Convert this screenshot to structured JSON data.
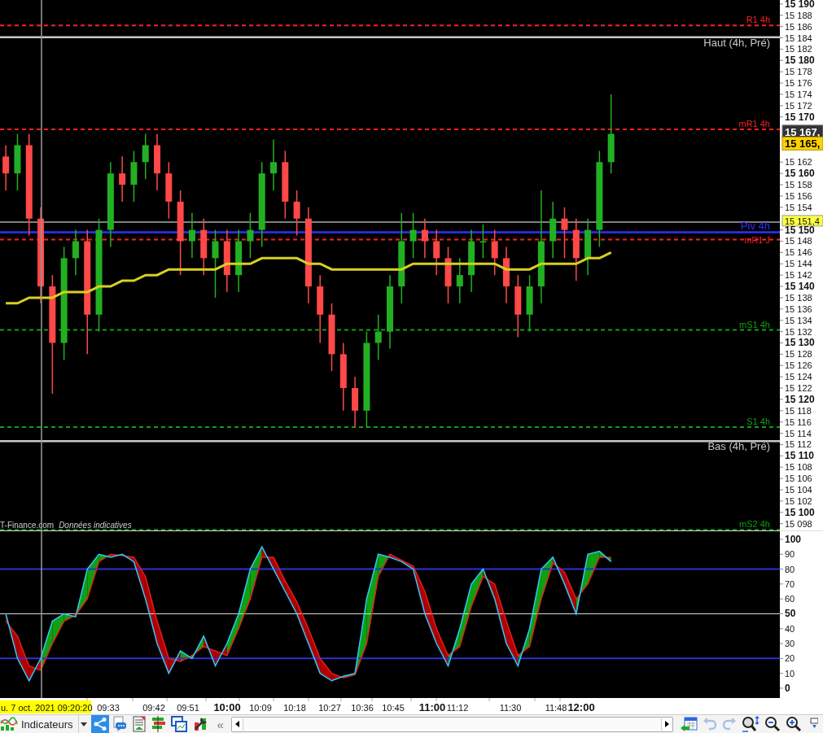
{
  "price_chart": {
    "credit": "T-Finance.com",
    "credit_note": "Données indicatives",
    "chart_data": {
      "type": "candlestick",
      "ylim": [
        15096.8,
        15190.7
      ],
      "categories": [
        null,
        null,
        null,
        null,
        null,
        null,
        null,
        null,
        null,
        null,
        null,
        null,
        null,
        null,
        null,
        null,
        null,
        null,
        null,
        null,
        null,
        null,
        null,
        null,
        null,
        null,
        null,
        null,
        null,
        null,
        null,
        null,
        null,
        null,
        null,
        null,
        null,
        null,
        null,
        null,
        null,
        null,
        null,
        null,
        null,
        null,
        null,
        null,
        null,
        null,
        null,
        null,
        null,
        null,
        null,
        null,
        null,
        null,
        null,
        null,
        null,
        null,
        null,
        null,
        null,
        null,
        null
      ],
      "yticks": [
        {
          "value": 15190,
          "label": "15 190"
        },
        {
          "value": 15188,
          "label": "15 188"
        },
        {
          "value": 15186,
          "label": "15 186"
        },
        {
          "value": 15184,
          "label": "15 184"
        },
        {
          "value": 15182,
          "label": "15 182"
        },
        {
          "value": 15180,
          "label": "15 180"
        },
        {
          "value": 15178,
          "label": "15 178"
        },
        {
          "value": 15176,
          "label": "15 176"
        },
        {
          "value": 15174,
          "label": "15 174"
        },
        {
          "value": 15172,
          "label": "15 172"
        },
        {
          "value": 15170,
          "label": "15 170"
        },
        {
          "value": 15162,
          "label": "15 162"
        },
        {
          "value": 15160,
          "label": "15 160"
        },
        {
          "value": 15158,
          "label": "15 158"
        },
        {
          "value": 15156,
          "label": "15 156"
        },
        {
          "value": 15154,
          "label": "15 154"
        },
        {
          "value": 15150,
          "label": "15 150"
        },
        {
          "value": 15148,
          "label": "15 148"
        },
        {
          "value": 15146,
          "label": "15 146"
        },
        {
          "value": 15144,
          "label": "15 144"
        },
        {
          "value": 15142,
          "label": "15 142"
        },
        {
          "value": 15140,
          "label": "15 140"
        },
        {
          "value": 15138,
          "label": "15 138"
        },
        {
          "value": 15136,
          "label": "15 136"
        },
        {
          "value": 15134,
          "label": "15 134"
        },
        {
          "value": 15132,
          "label": "15 132"
        },
        {
          "value": 15130,
          "label": "15 130"
        },
        {
          "value": 15128,
          "label": "15 128"
        },
        {
          "value": 15126,
          "label": "15 126"
        },
        {
          "value": 15124,
          "label": "15 124"
        },
        {
          "value": 15122,
          "label": "15 122"
        },
        {
          "value": 15120,
          "label": "15 120"
        },
        {
          "value": 15118,
          "label": "15 118"
        },
        {
          "value": 15116,
          "label": "15 116"
        },
        {
          "value": 15114,
          "label": "15 114"
        },
        {
          "value": 15112,
          "label": "15 112"
        },
        {
          "value": 15110,
          "label": "15 110"
        },
        {
          "value": 15108,
          "label": "15 108"
        },
        {
          "value": 15106,
          "label": "15 106"
        },
        {
          "value": 15104,
          "label": "15 104"
        },
        {
          "value": 15102,
          "label": "15 102"
        },
        {
          "value": 15100,
          "label": "15 100"
        },
        {
          "value": 15098,
          "label": "15 098"
        }
      ],
      "ohlc": [
        [
          15163,
          15165,
          15157,
          15160
        ],
        [
          15160,
          15167,
          15157,
          15165
        ],
        [
          15165,
          15167,
          15149,
          15152
        ],
        [
          15152,
          15154,
          15137,
          15140
        ],
        [
          15140,
          15142,
          15121,
          15130
        ],
        [
          15130,
          15147,
          15127,
          15145
        ],
        [
          15145,
          15150,
          15142,
          15148
        ],
        [
          15148,
          15150,
          15128,
          15135
        ],
        [
          15135,
          15152,
          15132,
          15150
        ],
        [
          15150,
          15162,
          15147,
          15160
        ],
        [
          15160,
          15163,
          15155,
          15158
        ],
        [
          15158,
          15164,
          15155,
          15162
        ],
        [
          15162,
          15167,
          15159,
          15165
        ],
        [
          15165,
          15167,
          15157,
          15160
        ],
        [
          15160,
          15162,
          15152,
          15155
        ],
        [
          15155,
          15157,
          15142,
          15148
        ],
        [
          15148,
          15153,
          15145,
          15150
        ],
        [
          15150,
          15152,
          15142,
          15145
        ],
        [
          15145,
          15150,
          15138,
          15148
        ],
        [
          15148,
          15150,
          15139,
          15142
        ],
        [
          15142,
          15150,
          15139,
          15148
        ],
        [
          15148,
          15153,
          15145,
          15150
        ],
        [
          15150,
          15162,
          15147,
          15160
        ],
        [
          15160,
          15166,
          15157,
          15162
        ],
        [
          15162,
          15164,
          15152,
          15155
        ],
        [
          15155,
          15157,
          15149,
          15152
        ],
        [
          15152,
          15154,
          15137,
          15140
        ],
        [
          15140,
          15142,
          15130,
          15135
        ],
        [
          15135,
          15137,
          15125,
          15128
        ],
        [
          15128,
          15130,
          15118,
          15122
        ],
        [
          15122,
          15124,
          15115,
          15118
        ],
        [
          15118,
          15132,
          15115,
          15130
        ],
        [
          15130,
          15135,
          15127,
          15132
        ],
        [
          15132,
          15142,
          15129,
          15140
        ],
        [
          15140,
          15153,
          15137,
          15148
        ],
        [
          15148,
          15153,
          15145,
          15150
        ],
        [
          15150,
          15152,
          15145,
          15148
        ],
        [
          15148,
          15150,
          15142,
          15145
        ],
        [
          15145,
          15147,
          15137,
          15140
        ],
        [
          15140,
          15145,
          15137,
          15142
        ],
        [
          15142,
          15150,
          15139,
          15148
        ],
        [
          15148,
          15151,
          15145,
          15148
        ],
        [
          15148,
          15150,
          15142,
          15145
        ],
        [
          15145,
          15147,
          15137,
          15140
        ],
        [
          15140,
          15142,
          15131,
          15135
        ],
        [
          15135,
          15142,
          15132,
          15140
        ],
        [
          15140,
          15157,
          15137,
          15148
        ],
        [
          15148,
          15155,
          15145,
          15152
        ],
        [
          15152,
          15154,
          15145,
          15150
        ],
        [
          15150,
          15152,
          15141,
          15145
        ],
        [
          15145,
          15152,
          15142,
          15150
        ],
        [
          15150,
          15164,
          15147,
          15162
        ],
        [
          15162,
          15174,
          15160,
          15167
        ],
        null,
        null,
        null,
        null,
        null,
        null,
        null,
        null,
        null,
        null,
        null,
        null,
        null,
        null
      ],
      "series": [
        {
          "type": "line",
          "color": "#d8d020",
          "values": [
            15137,
            15137,
            15138,
            15138,
            15138,
            15139,
            15139,
            15139,
            15140,
            15140,
            15141,
            15141,
            15142,
            15142,
            15143,
            15143,
            15143,
            15143,
            15143,
            15144,
            15144,
            15144,
            15145,
            15145,
            15145,
            15145,
            15144,
            15144,
            15143,
            15143,
            15143,
            15143,
            15143,
            15143,
            15143,
            15144,
            15144,
            15144,
            15144,
            15144,
            15144,
            15144,
            15144,
            15143,
            15143,
            15143,
            15144,
            15144,
            15144,
            15144,
            15145,
            15145,
            15146,
            null,
            null,
            null,
            null,
            null,
            null,
            null,
            null,
            null,
            null,
            null,
            null,
            null,
            null
          ]
        }
      ],
      "ref_lines": [
        {
          "axis": "y",
          "value": 15186.2,
          "label": "R1 4h",
          "color": "#ff2020"
        },
        {
          "axis": "y",
          "value": 15184.1,
          "label": "Haut (4h, Pré)",
          "color": "#c8c8c8"
        },
        {
          "axis": "y",
          "value": 15167.8,
          "label": "mR1 4h",
          "color": "#ff2020"
        },
        {
          "axis": "y",
          "value": 15151.4,
          "label": "15 151,4",
          "color": "#aaaaaa"
        },
        {
          "axis": "y",
          "value": 15149.6,
          "label": "Piv 4h",
          "color": "#3030ff"
        },
        {
          "axis": "y",
          "value": 15148.3,
          "label": "mR1 J",
          "color": "#ff2020"
        },
        {
          "axis": "y",
          "value": 15132.3,
          "label": "mS1 4h",
          "color": "#10a010"
        },
        {
          "axis": "y",
          "value": 15115.1,
          "label": "S1 4h",
          "color": "#10a010"
        },
        {
          "axis": "y",
          "value": 15112.6,
          "label": "Bas (4h, Pré)",
          "color": "#c8c8c8"
        },
        {
          "axis": "y",
          "value": 15096.9,
          "label": "mS2 4h",
          "color": "#10a010"
        }
      ],
      "annotations": [
        "15 167,",
        "15 165,"
      ]
    }
  },
  "oscillator": {
    "chart_data": {
      "type": "line",
      "ylim": [
        -6.6,
        106
      ],
      "categories": [
        null,
        null,
        null,
        null,
        null,
        null,
        null,
        null,
        null,
        null,
        null,
        null,
        null,
        null,
        null,
        null,
        null,
        null,
        null,
        null,
        null,
        null,
        null,
        null,
        null,
        null,
        null,
        null,
        null,
        null,
        null,
        null,
        null,
        null,
        null,
        null,
        null,
        null,
        null,
        null,
        null,
        null,
        null,
        null,
        null,
        null,
        null,
        null,
        null,
        null,
        null,
        null,
        null,
        null,
        null,
        null,
        null,
        null,
        null,
        null,
        null,
        null,
        null,
        null,
        null,
        null,
        null
      ],
      "yticks": [
        {
          "value": 100,
          "label": "100"
        },
        {
          "value": 90,
          "label": "90"
        },
        {
          "value": 80,
          "label": "80"
        },
        {
          "value": 70,
          "label": "70"
        },
        {
          "value": 60,
          "label": "60"
        },
        {
          "value": 50,
          "label": "50"
        },
        {
          "value": 40,
          "label": "40"
        },
        {
          "value": 30,
          "label": "30"
        },
        {
          "value": 20,
          "label": "20"
        },
        {
          "value": 10,
          "label": "10"
        },
        {
          "value": 0,
          "label": "0"
        }
      ],
      "series": [
        {
          "color": "#30c8ff",
          "values": [
            50,
            20,
            5,
            20,
            45,
            50,
            48,
            80,
            90,
            88,
            90,
            85,
            60,
            30,
            10,
            25,
            20,
            35,
            15,
            30,
            50,
            80,
            95,
            80,
            65,
            50,
            30,
            10,
            5,
            8,
            10,
            60,
            90,
            88,
            85,
            80,
            50,
            30,
            15,
            40,
            70,
            80,
            60,
            30,
            15,
            40,
            80,
            88,
            70,
            50,
            90,
            92,
            85,
            null,
            null,
            null,
            null,
            null,
            null,
            null,
            null,
            null,
            null,
            null,
            null,
            null,
            null
          ]
        },
        {
          "color": "#e02020",
          "values": [
            45,
            35,
            15,
            12,
            30,
            45,
            49,
            60,
            85,
            90,
            89,
            88,
            75,
            45,
            20,
            18,
            22,
            28,
            25,
            22,
            40,
            60,
            88,
            88,
            72,
            58,
            40,
            20,
            10,
            7,
            9,
            30,
            75,
            90,
            86,
            82,
            65,
            40,
            22,
            28,
            55,
            75,
            70,
            45,
            22,
            28,
            60,
            84,
            78,
            60,
            70,
            88,
            88,
            null,
            null,
            null,
            null,
            null,
            null,
            null,
            null,
            null,
            null,
            null,
            null,
            null,
            null
          ]
        }
      ],
      "ref_lines": [
        {
          "axis": "y",
          "value": 80,
          "color": "#3030d0"
        },
        {
          "axis": "y",
          "value": 50,
          "color": "#e0e0e0"
        },
        {
          "axis": "y",
          "value": 20,
          "color": "#3030d0"
        }
      ]
    }
  },
  "time_axis": {
    "cursor_label": "u. 7 oct. 2021 09:20:20",
    "labels": [
      {
        "label": "09:33",
        "major": false
      },
      {
        "label": "09:42",
        "major": false
      },
      {
        "label": "09:51",
        "major": false
      },
      {
        "label": "10:00",
        "major": true
      },
      {
        "label": "10:09",
        "major": false
      },
      {
        "label": "10:18",
        "major": false
      },
      {
        "label": "10:27",
        "major": false
      },
      {
        "label": "10:36",
        "major": false
      },
      {
        "label": "10:45",
        "major": false
      },
      {
        "label": "11:00",
        "major": true
      },
      {
        "label": "11:12",
        "major": false
      },
      {
        "label": "11:30",
        "major": false
      },
      {
        "label": "11:48",
        "major": false
      },
      {
        "label": "12:00",
        "major": true
      }
    ]
  },
  "toolbar": {
    "indicators_label": "Indicateurs",
    "collapse_label": "«",
    "items": [
      {
        "kind": "share",
        "disabled": false
      },
      {
        "kind": "comment",
        "disabled": false
      },
      {
        "kind": "report",
        "disabled": false
      },
      {
        "kind": "bars",
        "disabled": false
      },
      {
        "kind": "windows",
        "disabled": false
      },
      {
        "kind": "tools",
        "disabled": false
      }
    ],
    "right_items": [
      {
        "kind": "calendar",
        "disabled": false
      },
      {
        "kind": "undo",
        "disabled": true
      },
      {
        "kind": "redo",
        "disabled": true
      },
      {
        "kind": "zoom-fit",
        "disabled": false
      },
      {
        "kind": "zoom-out",
        "disabled": false
      },
      {
        "kind": "zoom-in",
        "disabled": false
      },
      {
        "kind": "more",
        "disabled": false
      }
    ]
  }
}
